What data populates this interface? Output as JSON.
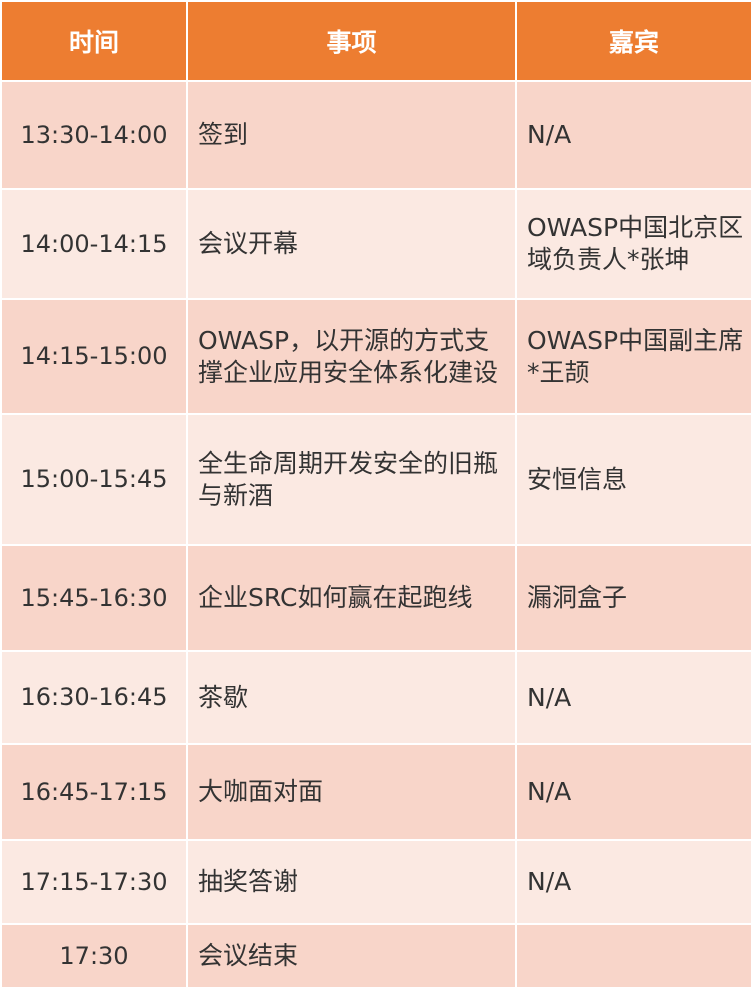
{
  "header": {
    "time": "时间",
    "item": "事项",
    "guest": "嘉宾"
  },
  "rows": [
    {
      "time": "13:30-14:00",
      "item": "签到",
      "guest": "N/A"
    },
    {
      "time": "14:00-14:15",
      "item": "会议开幕",
      "guest": "OWASP中国北京区域负责人*张坤"
    },
    {
      "time": "14:15-15:00",
      "item": "OWASP，以开源的方式支撑企业应用安全体系化建设",
      "guest": "OWASP中国副主席*王颉"
    },
    {
      "time": "15:00-15:45",
      "item": "全生命周期开发安全的旧瓶与新酒",
      "guest": "安恒信息"
    },
    {
      "time": "15:45-16:30",
      "item": "企业SRC如何赢在起跑线",
      "guest": "漏洞盒子"
    },
    {
      "time": "16:30-16:45",
      "item": "茶歇",
      "guest": "N/A"
    },
    {
      "time": "16:45-17:15",
      "item": "大咖面对面",
      "guest": "N/A"
    },
    {
      "time": "17:15-17:30",
      "item": "抽奖答谢",
      "guest": "N/A"
    },
    {
      "time": "17:30",
      "item": "会议结束",
      "guest": ""
    }
  ],
  "colors": {
    "header_bg": "#ed7d31",
    "row_dark": "#f8d5c9",
    "row_light": "#fbe9e2"
  }
}
